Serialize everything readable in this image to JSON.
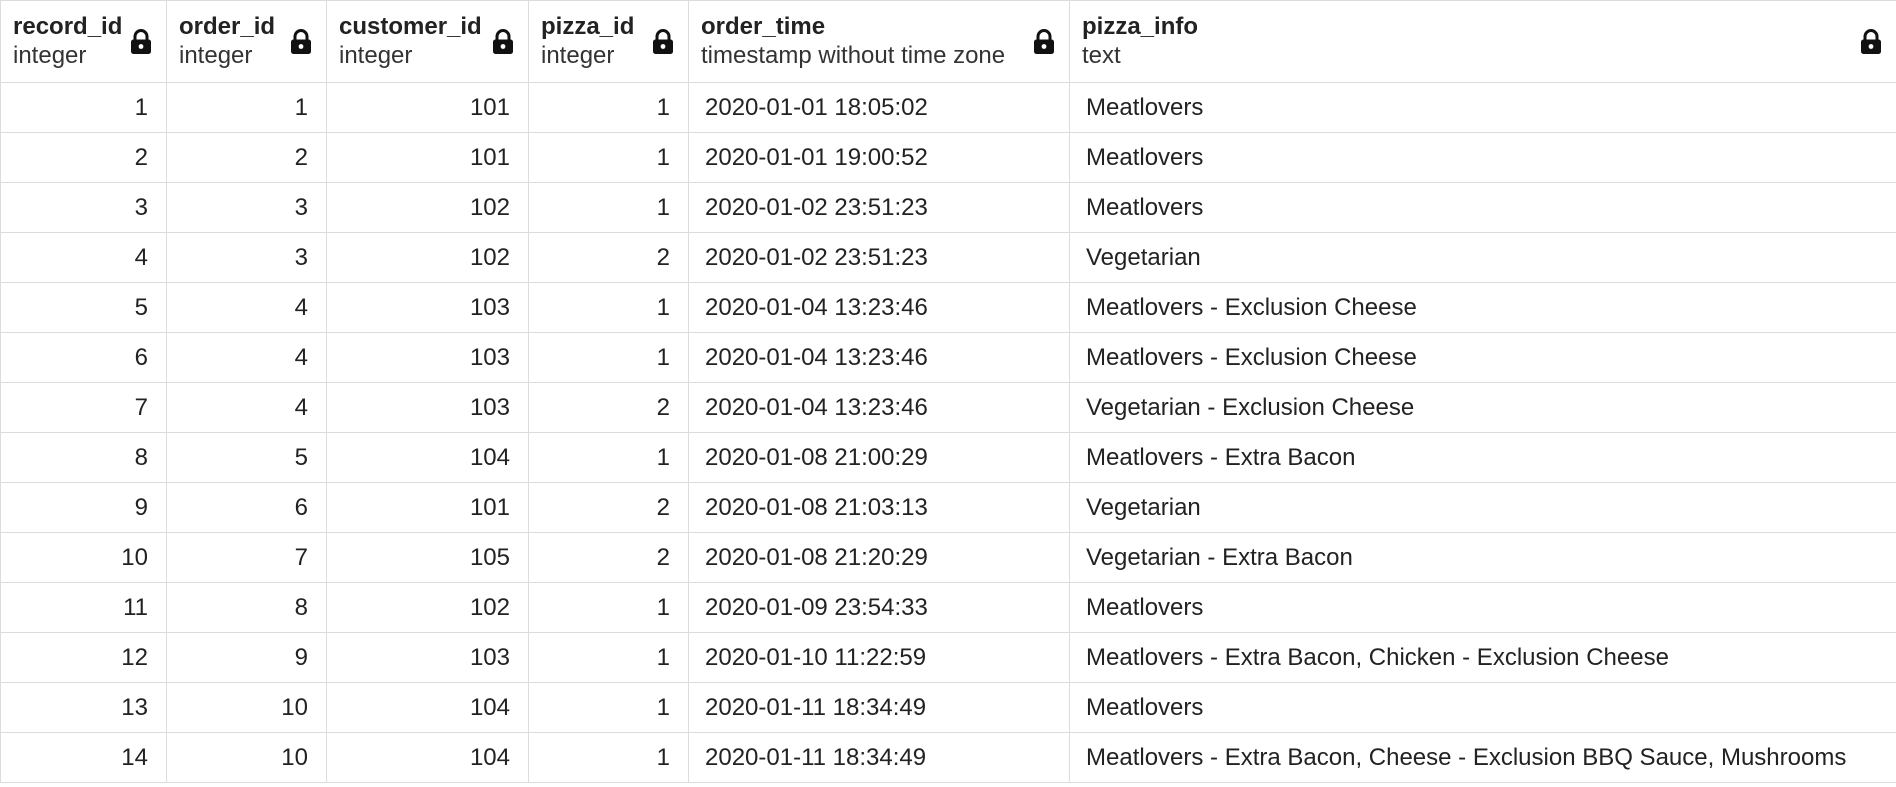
{
  "columns": [
    {
      "name": "record_id",
      "type": "integer",
      "icon": "lock-icon",
      "align": "right"
    },
    {
      "name": "order_id",
      "type": "integer",
      "icon": "lock-icon",
      "align": "right"
    },
    {
      "name": "customer_id",
      "type": "integer",
      "icon": "lock-icon",
      "align": "right"
    },
    {
      "name": "pizza_id",
      "type": "integer",
      "icon": "lock-icon",
      "align": "right"
    },
    {
      "name": "order_time",
      "type": "timestamp without time zone",
      "icon": "lock-icon",
      "align": "left"
    },
    {
      "name": "pizza_info",
      "type": "text",
      "icon": "lock-icon",
      "align": "left"
    }
  ],
  "rows": [
    [
      "1",
      "1",
      "101",
      "1",
      "2020-01-01 18:05:02",
      "Meatlovers"
    ],
    [
      "2",
      "2",
      "101",
      "1",
      "2020-01-01 19:00:52",
      "Meatlovers"
    ],
    [
      "3",
      "3",
      "102",
      "1",
      "2020-01-02 23:51:23",
      "Meatlovers"
    ],
    [
      "4",
      "3",
      "102",
      "2",
      "2020-01-02 23:51:23",
      "Vegetarian"
    ],
    [
      "5",
      "4",
      "103",
      "1",
      "2020-01-04 13:23:46",
      "Meatlovers - Exclusion Cheese"
    ],
    [
      "6",
      "4",
      "103",
      "1",
      "2020-01-04 13:23:46",
      "Meatlovers - Exclusion Cheese"
    ],
    [
      "7",
      "4",
      "103",
      "2",
      "2020-01-04 13:23:46",
      "Vegetarian - Exclusion Cheese"
    ],
    [
      "8",
      "5",
      "104",
      "1",
      "2020-01-08 21:00:29",
      "Meatlovers - Extra Bacon"
    ],
    [
      "9",
      "6",
      "101",
      "2",
      "2020-01-08 21:03:13",
      "Vegetarian"
    ],
    [
      "10",
      "7",
      "105",
      "2",
      "2020-01-08 21:20:29",
      "Vegetarian - Extra Bacon"
    ],
    [
      "11",
      "8",
      "102",
      "1",
      "2020-01-09 23:54:33",
      "Meatlovers"
    ],
    [
      "12",
      "9",
      "103",
      "1",
      "2020-01-10 11:22:59",
      "Meatlovers - Extra Bacon, Chicken - Exclusion Cheese"
    ],
    [
      "13",
      "10",
      "104",
      "1",
      "2020-01-11 18:34:49",
      "Meatlovers"
    ],
    [
      "14",
      "10",
      "104",
      "1",
      "2020-01-11 18:34:49",
      "Meatlovers - Extra Bacon, Cheese - Exclusion BBQ Sauce, Mushrooms"
    ]
  ]
}
